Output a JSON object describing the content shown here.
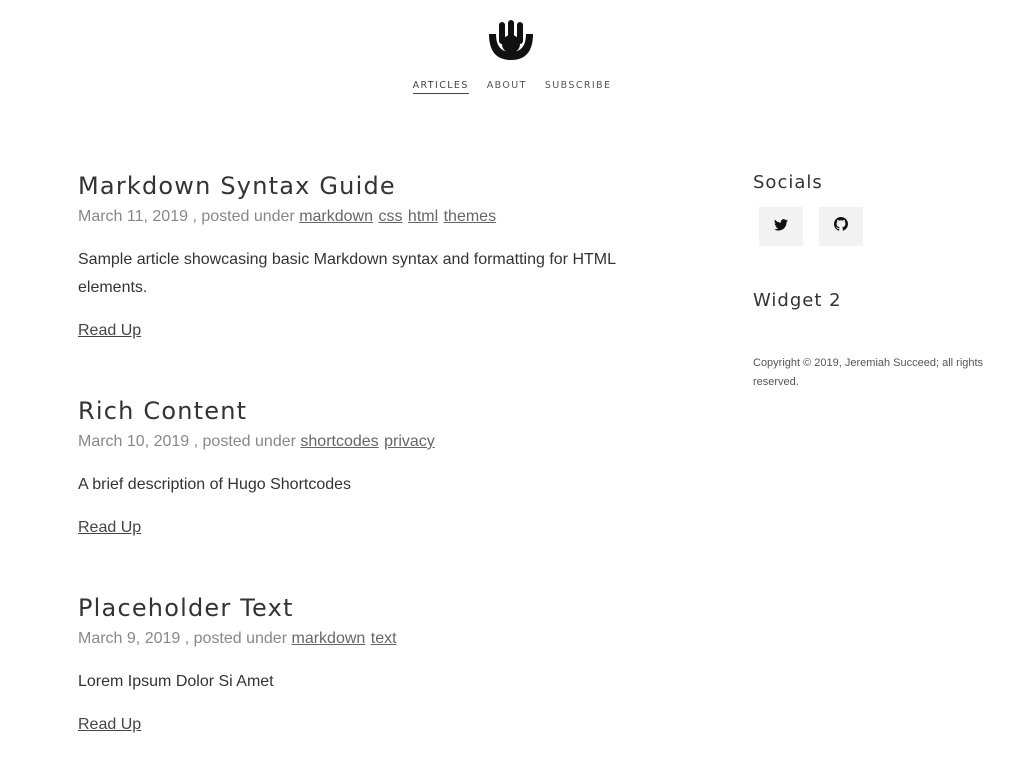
{
  "header": {
    "logo_icon": "hand-gesture-logo",
    "nav": [
      {
        "label": "ARTICLES",
        "active": true
      },
      {
        "label": "ABOUT",
        "active": false
      },
      {
        "label": "SUBSCRIBE",
        "active": false
      }
    ]
  },
  "posts": [
    {
      "title": "Markdown Syntax Guide",
      "date": "March 11, 2019",
      "posted_under": ", posted under",
      "tags": [
        "markdown",
        "css",
        "html",
        "themes"
      ],
      "summary": "Sample article showcasing basic Markdown syntax and formatting for HTML elements.",
      "read_more": "Read Up"
    },
    {
      "title": "Rich Content",
      "date": "March 10, 2019",
      "posted_under": ", posted under",
      "tags": [
        "shortcodes",
        "privacy"
      ],
      "summary": "A brief description of Hugo Shortcodes",
      "read_more": "Read Up"
    },
    {
      "title": "Placeholder Text",
      "date": "March 9, 2019",
      "posted_under": ", posted under",
      "tags": [
        "markdown",
        "text"
      ],
      "summary": "Lorem Ipsum Dolor Si Amet",
      "read_more": "Read Up"
    }
  ],
  "sidebar": {
    "socials_title": "Socials",
    "socials": [
      {
        "icon": "twitter-icon"
      },
      {
        "icon": "github-icon"
      }
    ],
    "widget2_title": "Widget 2",
    "copyright": "Copyright © 2019, Jeremiah Succeed; all rights reserved."
  },
  "colors": {
    "background": "#ffffff",
    "text": "#333333",
    "meta": "#888888",
    "social_bg": "#f2f2f2"
  }
}
